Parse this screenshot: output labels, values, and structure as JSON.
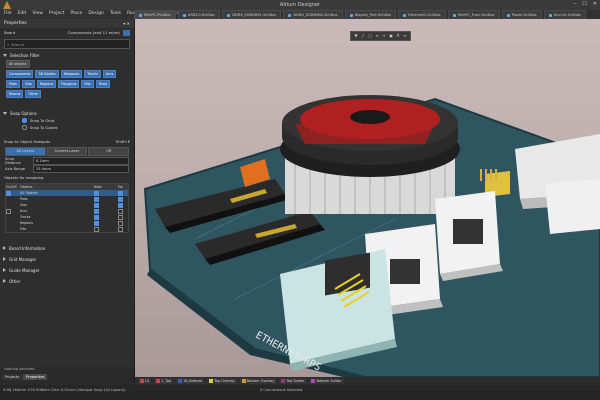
{
  "window": {
    "title": "Altium Designer",
    "controls": [
      "–",
      "☐",
      "✕"
    ]
  },
  "menu": [
    "File",
    "Edit",
    "View",
    "Project",
    "Place",
    "Design",
    "Tools",
    "Route",
    "Reports",
    "Window",
    "Help"
  ],
  "doc_tabs": [
    "MiniPC.PcbDoc",
    "USB3.0.SchDoc",
    "DDR4_SODIMM1.SchDoc",
    "DDR4_SODIMM2.SchDoc",
    "Display_Port.SchDoc",
    "Ethernet1.SchDoc",
    "MiniPC_Func.SchDoc",
    "Power.SchDoc",
    "Xcvr10.SchDoc"
  ],
  "panel": {
    "title": "Properties",
    "board_label": "Board",
    "board_value": "Components (and 11 more)",
    "search_placeholder": "Search",
    "selection_filter": "Selection Filter",
    "all_objects": "All objects",
    "filters": [
      "Components",
      "3D Bodies",
      "Keepouts",
      "Tracks",
      "Arcs",
      "Pads",
      "Vias",
      "Regions",
      "Polygons",
      "Fills",
      "Texts",
      "Rooms",
      "Other"
    ],
    "snap_options": "Snap Options",
    "snap_to_grids": "Snap To Grids",
    "snap_to_guides": "Snap To Guides",
    "snap_hotspots": "Snap to Object Hotspots",
    "shortcut": "Shift+E",
    "layer_modes": [
      "All Layers",
      "Current Layer",
      "Off"
    ],
    "snap_distance_label": "Snap Distance",
    "snap_distance_value": "0.1mm",
    "axis_range_label": "Axis Range",
    "axis_range_value": "25.4mm",
    "objects_for_snapping": "Objects for snapping",
    "table_headers": [
      "On/Off",
      "Objects",
      "",
      "Near",
      "",
      "Far"
    ],
    "table_rows": [
      "All Objects",
      "Pads",
      "Vias",
      "Arcs",
      "Tracks",
      "Regions",
      "Fills"
    ],
    "board_information": "Board Information",
    "grid_manager": "Grid Manager",
    "guide_manager": "Guide Manager",
    "other": "Other",
    "status_msg": "Nothing selected",
    "bottom_tabs": [
      "Projects",
      "Properties"
    ]
  },
  "layers": [
    {
      "name": "LS",
      "color": "#c94a4a"
    },
    {
      "name": "1_Top",
      "color": "#d64545"
    },
    {
      "name": "16_Bottom",
      "color": "#3b5fc8"
    },
    {
      "name": "Top Overlay",
      "color": "#e0d040"
    },
    {
      "name": "Bottom Overlay",
      "color": "#d09a30"
    },
    {
      "name": "Top Solder",
      "color": "#8a3a8a"
    },
    {
      "name": "Bottom Solder",
      "color": "#b04ab0"
    }
  ],
  "status": {
    "coords": "X:98.164mm Y:55.908mm   Grid: 0.01mm   (Hotspot Snap (All Layers))",
    "connections": "0 Connections Selected"
  },
  "board": {
    "label": "ETHERNET-RPS"
  }
}
